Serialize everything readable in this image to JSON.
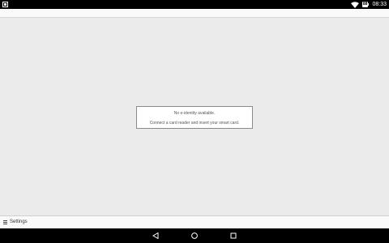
{
  "status_bar": {
    "time": "08:33",
    "battery": "88",
    "icons": [
      "notification-icon",
      "wifi-icon",
      "battery-icon"
    ]
  },
  "dialog": {
    "title": "No e-identity available.",
    "message": "Connect a card reader and insert your smart card."
  },
  "bottom_bar": {
    "settings_label": "Settings"
  },
  "nav_bar": {
    "buttons": [
      "back-icon",
      "home-icon",
      "recents-icon"
    ]
  }
}
